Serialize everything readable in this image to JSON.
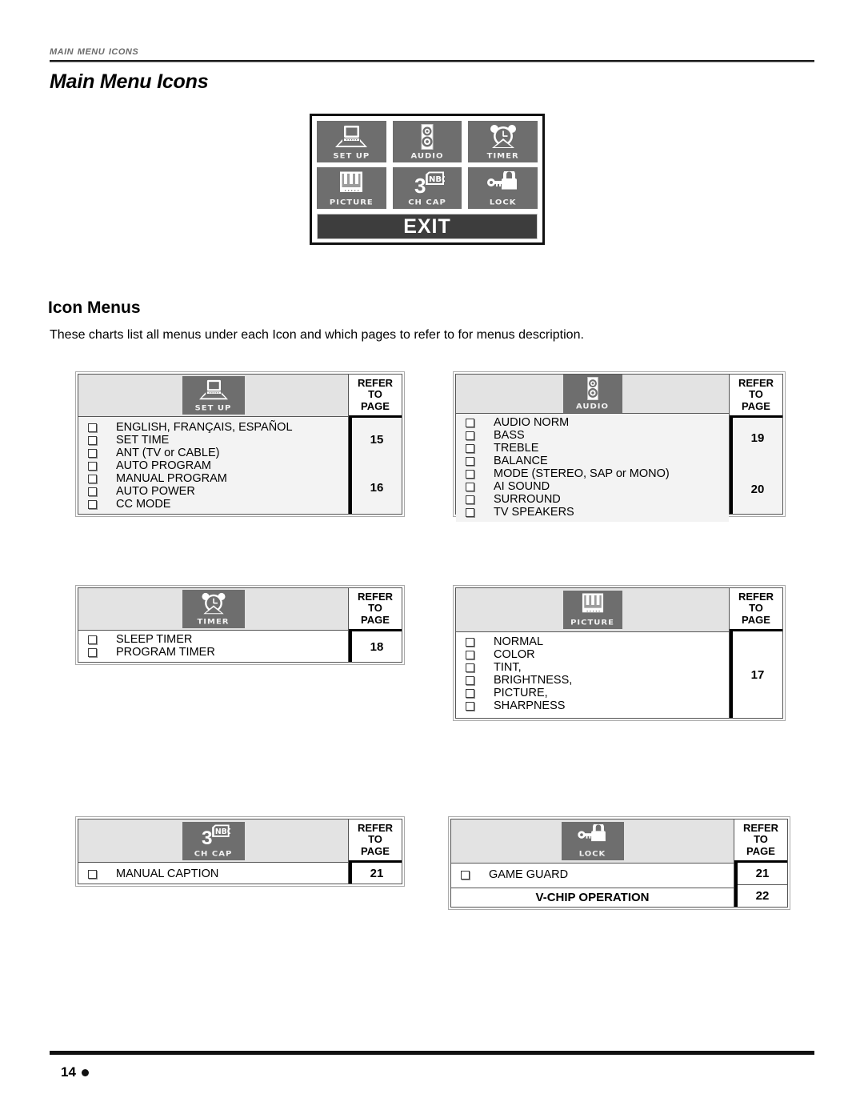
{
  "running_head": "MAIN MENU ICONS",
  "page_title": "Main Menu Icons",
  "osd": {
    "tiles": [
      {
        "label": "SET UP",
        "icon": "tv-setup-icon"
      },
      {
        "label": "AUDIO",
        "icon": "speaker-icon"
      },
      {
        "label": "TIMER",
        "icon": "alarm-clock-icon"
      },
      {
        "label": "PICTURE",
        "icon": "tv-colorbars-icon"
      },
      {
        "label": "CH CAP",
        "icon": "channel-caption-icon"
      },
      {
        "label": "LOCK",
        "icon": "padlock-key-icon"
      }
    ],
    "exit_label": "EXIT"
  },
  "section": {
    "heading": "Icon Menus",
    "intro": "These charts list all menus under each Icon and which pages to refer to for menus description."
  },
  "refer_header": {
    "line1": "REFER",
    "line2": "TO",
    "line3": "PAGE"
  },
  "charts": [
    {
      "icon": "tv-setup-icon",
      "icon_label": "SET UP",
      "items": [
        "ENGLISH, FRANÇAIS, ESPAÑOL",
        "SET TIME",
        "ANT (TV or CABLE)",
        "AUTO PROGRAM",
        "MANUAL PROGRAM",
        "AUTO POWER",
        "CC MODE"
      ],
      "pages": [
        "15",
        "16"
      ]
    },
    {
      "icon": "speaker-icon",
      "icon_label": "AUDIO",
      "items": [
        "AUDIO NORM",
        "BASS",
        "TREBLE",
        "BALANCE",
        "MODE (STEREO, SAP or MONO)",
        "AI SOUND",
        "SURROUND",
        "TV SPEAKERS"
      ],
      "pages": [
        "19",
        "20"
      ]
    },
    {
      "icon": "alarm-clock-icon",
      "icon_label": "TIMER",
      "items": [
        "SLEEP TIMER",
        "PROGRAM TIMER"
      ],
      "pages": [
        "18"
      ]
    },
    {
      "icon": "tv-colorbars-icon",
      "icon_label": "PICTURE",
      "items": [
        "NORMAL",
        "COLOR",
        "TINT,",
        "BRIGHTNESS,",
        "PICTURE,",
        "SHARPNESS"
      ],
      "pages": [
        "17"
      ]
    },
    {
      "icon": "channel-caption-icon",
      "icon_label": "CH CAP",
      "items": [
        "MANUAL CAPTION"
      ],
      "pages": [
        "21"
      ]
    },
    {
      "icon": "padlock-key-icon",
      "icon_label": "LOCK",
      "items": [
        "GAME GUARD"
      ],
      "extra_row": "V-CHIP OPERATION",
      "pages": [
        "21",
        "22"
      ]
    }
  ],
  "footer": {
    "page_number": "14"
  },
  "colors": {
    "icon_tile": "#6e6e6e",
    "header_band": "#e3e3e3",
    "body_fill": "#f3f3f3",
    "exit_bar": "#3d3d3d",
    "rule": "#111111"
  }
}
